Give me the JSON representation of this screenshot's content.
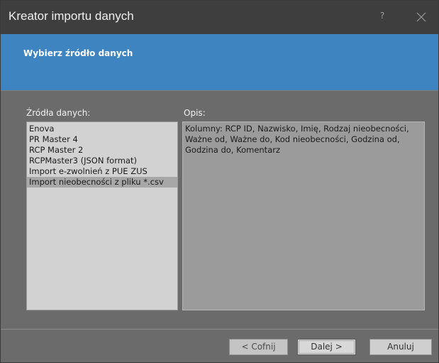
{
  "window": {
    "title": "Kreator importu danych",
    "help_label": "?"
  },
  "banner": {
    "title": "Wybierz źródło danych"
  },
  "sources": {
    "label": "Źródła danych:",
    "items": [
      {
        "label": "Enova",
        "selected": false
      },
      {
        "label": "PR Master 4",
        "selected": false
      },
      {
        "label": "RCP Master 2",
        "selected": false
      },
      {
        "label": "RCPMaster3 (JSON format)",
        "selected": false
      },
      {
        "label": "Import e-zwolnień z PUE ZUS",
        "selected": false
      },
      {
        "label": "Import nieobecności z pliku *.csv",
        "selected": true
      }
    ]
  },
  "description": {
    "label": "Opis:",
    "text": "Kolumny: RCP ID, Nazwisko, Imię, Rodzaj nieobecności,\nWażne od, Ważne do, Kod nieobecności, Godzina od,\nGodzina do, Komentarz"
  },
  "buttons": {
    "back_label": "< Cofnij",
    "next_label": "Dalej >",
    "cancel_label": "Anuluj"
  },
  "colors": {
    "titlebar": "#3e3e3e",
    "banner": "#3e84c0",
    "body": "#6b6b6b",
    "list_bg": "#d2d2d2",
    "list_selected": "#a7a7a7",
    "desc_bg": "#9b9b9b"
  },
  "icons": {
    "close": "close-icon"
  }
}
